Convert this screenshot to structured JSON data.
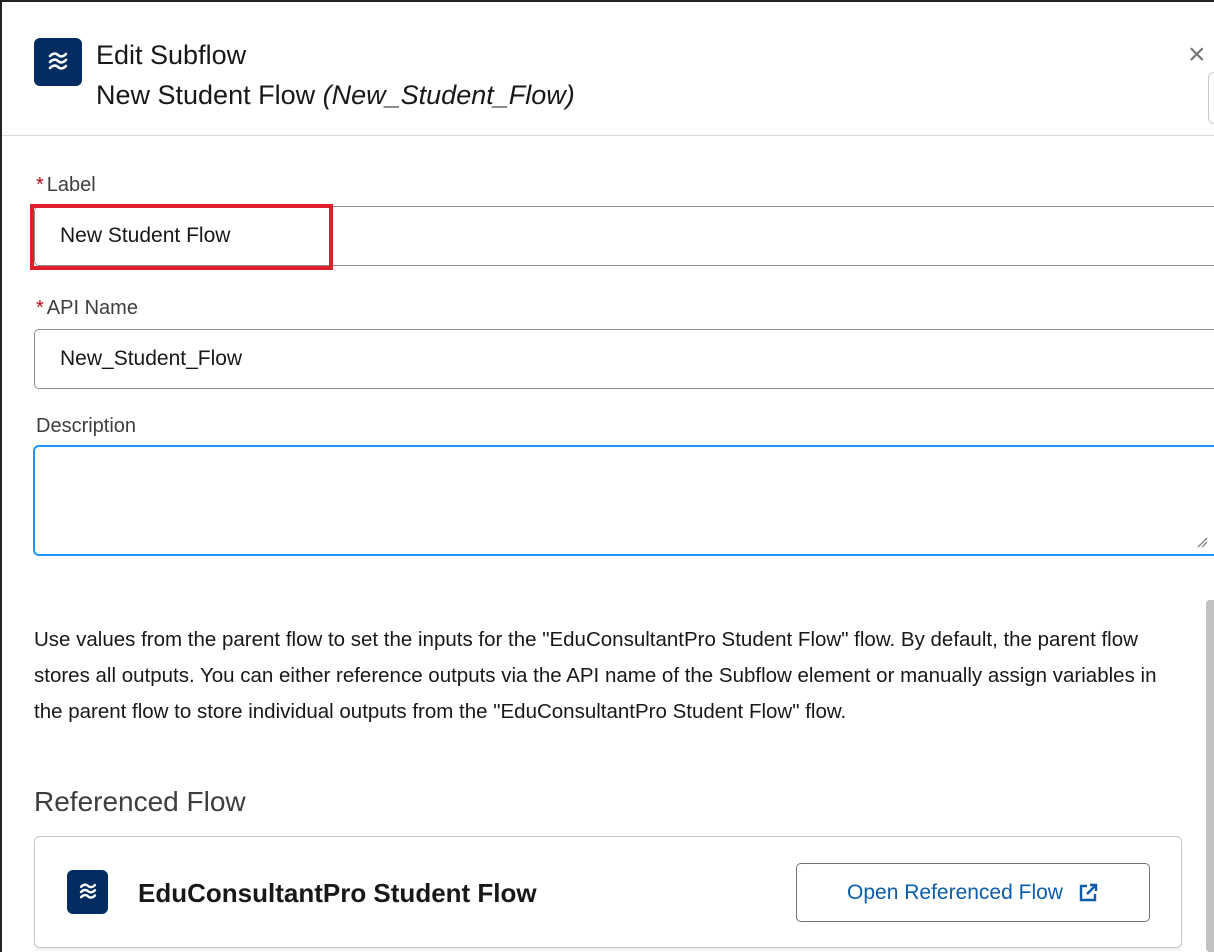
{
  "modal": {
    "title": "Edit Subflow",
    "subtitle_name": "New Student Flow",
    "subtitle_api": "(New_Student_Flow)",
    "close_glyph": "×",
    "icon": "flow-icon"
  },
  "form": {
    "label": {
      "required_mark": "*",
      "text": "Label",
      "value": "New Student Flow"
    },
    "api_name": {
      "required_mark": "*",
      "text": "API Name",
      "value": "New_Student_Flow"
    },
    "description": {
      "text": "Description",
      "value": ""
    }
  },
  "info": {
    "text": "Use values from the parent flow to set the inputs for the \"EduConsultantPro Student Flow\" flow. By default, the parent flow stores all outputs. You can either reference outputs via the API name of the Subflow element or manually assign variables in the parent flow to store individual outputs from the \"EduConsultantPro Student Flow\" flow."
  },
  "referenced_flow": {
    "section_title": "Referenced Flow",
    "name": "EduConsultantPro Student Flow",
    "open_button_label": "Open Referenced Flow",
    "open_icon": "external-link-icon"
  },
  "colors": {
    "icon_bg": "#032d60",
    "link": "#0b5cab",
    "required": "#ba0517",
    "highlight": "#e01e2a",
    "focus": "#1b96ff"
  }
}
